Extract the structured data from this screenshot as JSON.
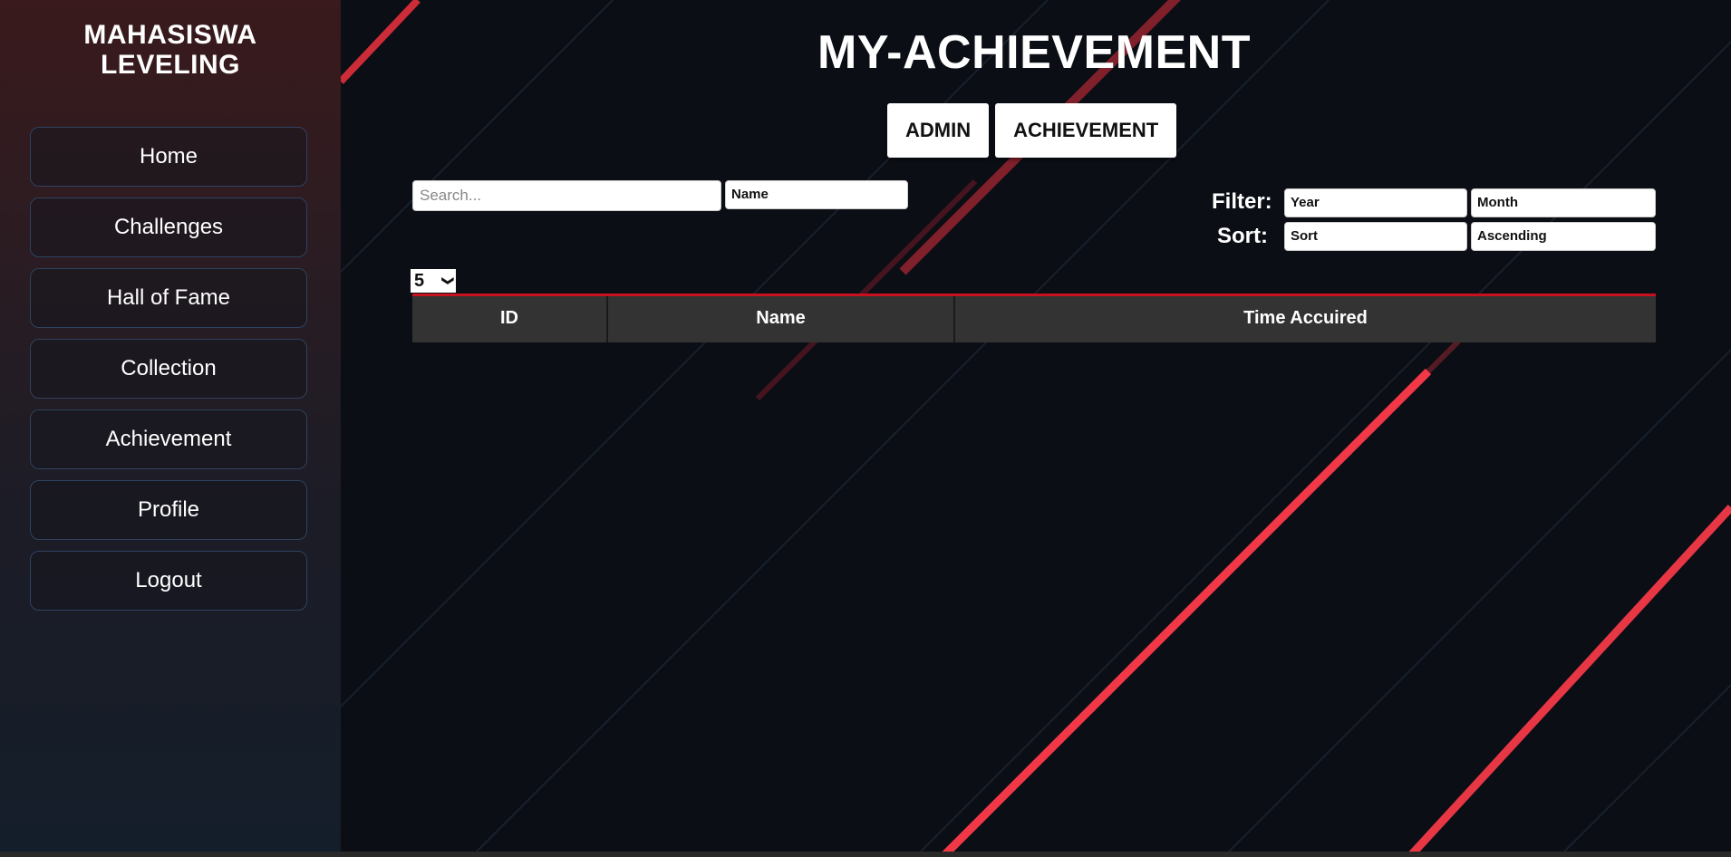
{
  "sidebar": {
    "brand_line1": "MAHASISWA",
    "brand_line2": "LEVELING",
    "items": [
      {
        "label": "Home"
      },
      {
        "label": "Challenges"
      },
      {
        "label": "Hall of Fame"
      },
      {
        "label": "Collection"
      },
      {
        "label": "Achievement"
      },
      {
        "label": "Profile"
      },
      {
        "label": "Logout"
      }
    ]
  },
  "main": {
    "title": "MY-ACHIEVEMENT",
    "buttons": {
      "admin": "ADMIN",
      "achievement": "ACHIEVEMENT"
    },
    "search": {
      "placeholder": "Search...",
      "field": "Name"
    },
    "filter": {
      "label": "Filter:",
      "year": "Year",
      "month": "Month"
    },
    "sort": {
      "label": "Sort:",
      "field": "Sort",
      "order": "Ascending"
    },
    "page_size": "5",
    "table": {
      "columns": [
        "ID",
        "Name",
        "Time Accuired"
      ],
      "rows": []
    }
  },
  "colors": {
    "accent": "#c8101e",
    "table_header": "#333333"
  }
}
